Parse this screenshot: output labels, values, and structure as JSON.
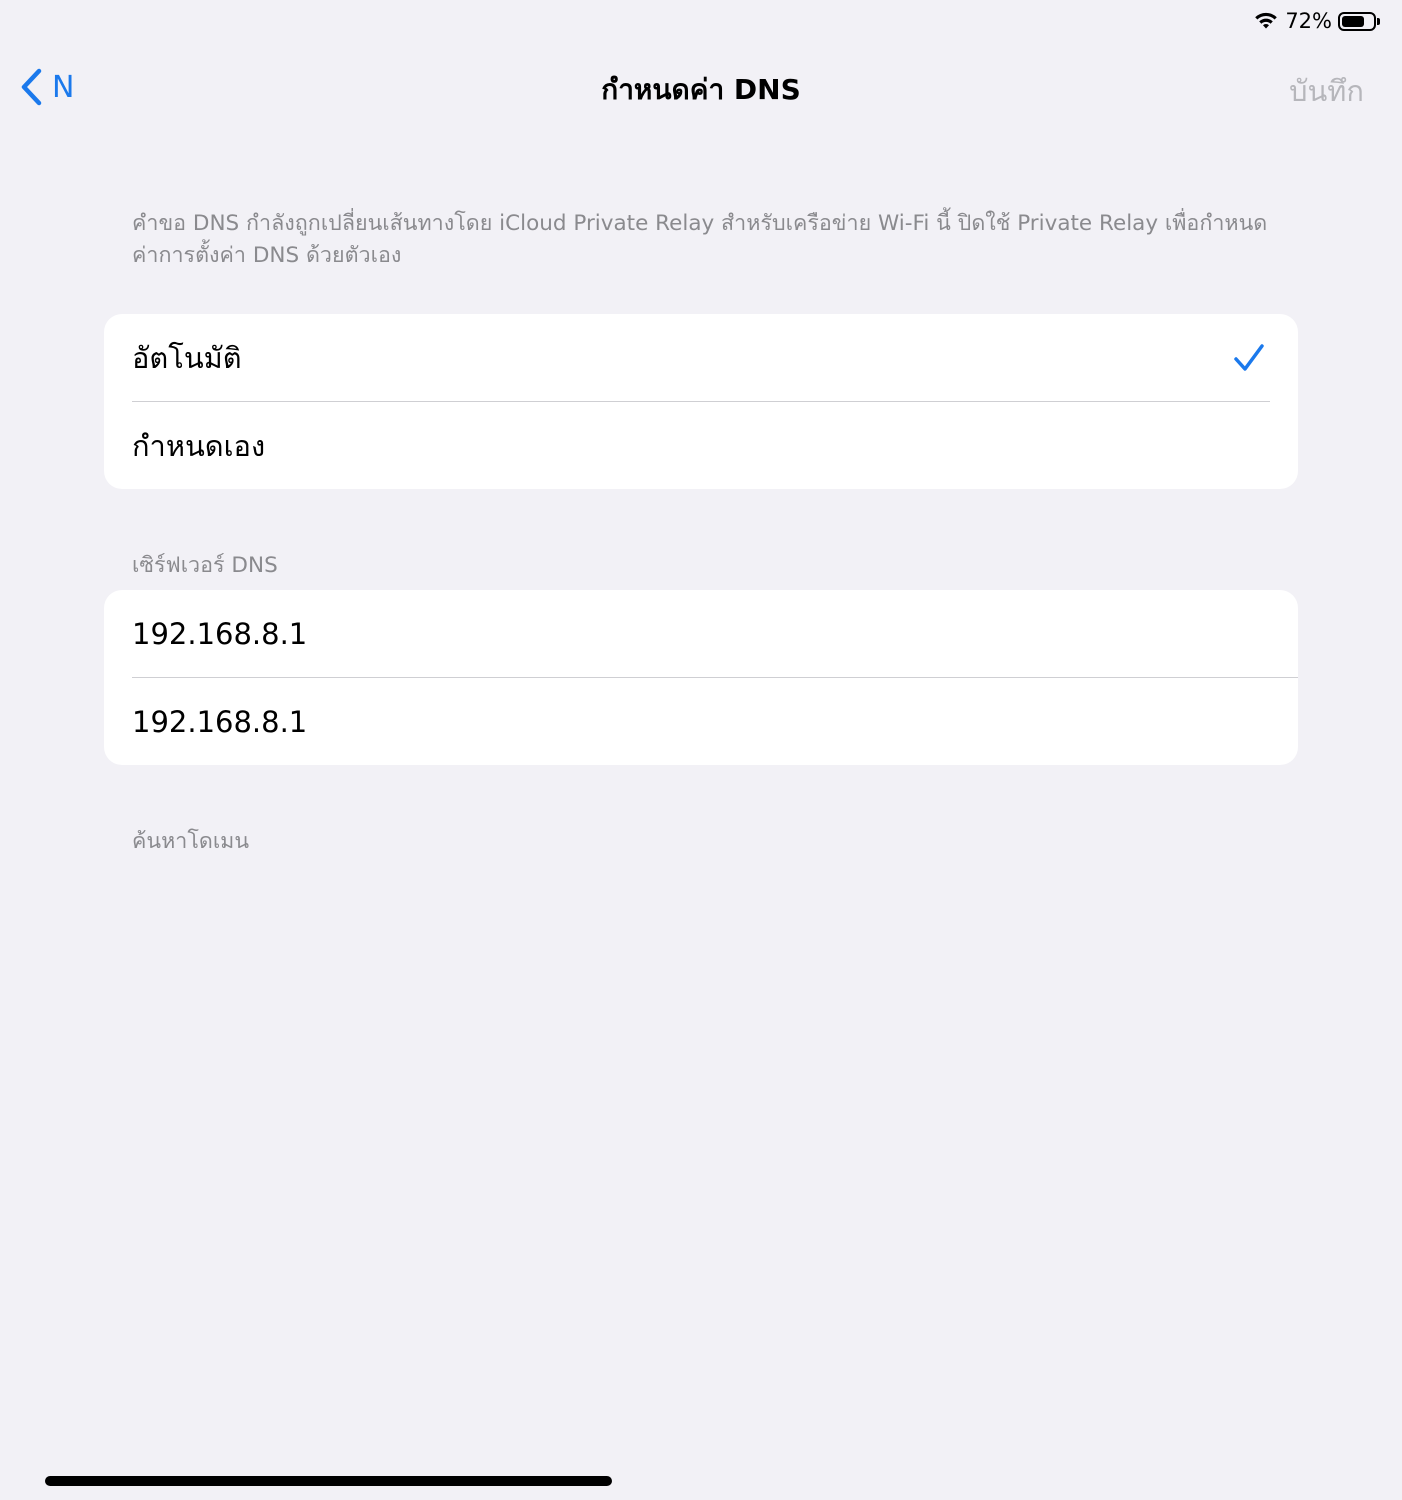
{
  "status_bar": {
    "battery_text": "72%",
    "battery_level": 0.72,
    "icons": [
      "wifi-icon",
      "battery-icon"
    ]
  },
  "navbar": {
    "back_label": "N",
    "title": "กำหนดค่า DNS",
    "save_label": "บันทึก"
  },
  "notice": "คำขอ DNS กำลังถูกเปลี่ยนเส้นทางโดย iCloud Private Relay สำหรับเครือข่าย Wi-Fi นี้ ปิดใช้ Private Relay เพื่อกำหนดค่าการตั้งค่า DNS ด้วยตัวเอง",
  "mode": {
    "options": [
      {
        "label": "อัตโนมัติ",
        "selected": true
      },
      {
        "label": "กำหนดเอง",
        "selected": false
      }
    ]
  },
  "dns_servers": {
    "header": "เซิร์ฟเวอร์ DNS",
    "items": [
      "192.168.8.1",
      "192.168.8.1"
    ]
  },
  "search_domains": {
    "header": "ค้นหาโดเมน"
  },
  "colors": {
    "accent": "#1b79ec",
    "background": "#f2f1f6",
    "secondary_text": "#8a8a8e",
    "disabled": "#b6b6bb"
  }
}
